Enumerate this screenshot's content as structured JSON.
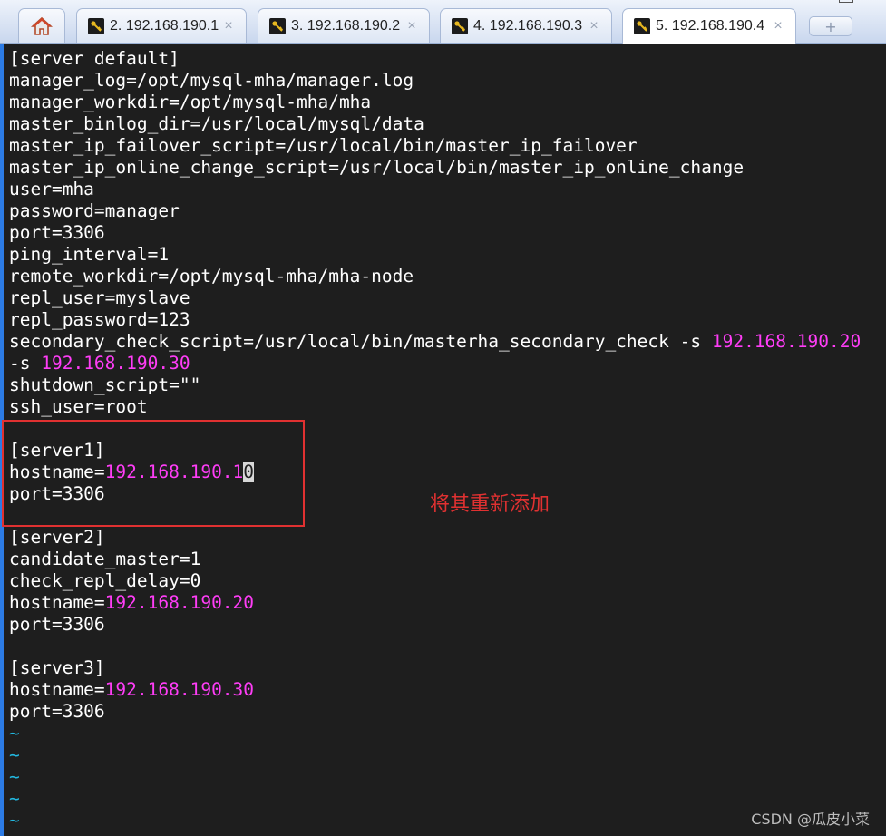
{
  "tabs": [
    {
      "label": "2. 192.168.190.1",
      "active": false
    },
    {
      "label": "3. 192.168.190.2",
      "active": false
    },
    {
      "label": "4. 192.168.190.3",
      "active": false
    },
    {
      "label": "5. 192.168.190.4",
      "active": true
    }
  ],
  "tab_close_glyph": "×",
  "new_tab_glyph": "+",
  "terminal": {
    "lines": [
      {
        "text": "[server default]"
      },
      {
        "text": "manager_log=/opt/mysql-mha/manager.log"
      },
      {
        "text": "manager_workdir=/opt/mysql-mha/mha"
      },
      {
        "text": "master_binlog_dir=/usr/local/mysql/data"
      },
      {
        "text": "master_ip_failover_script=/usr/local/bin/master_ip_failover"
      },
      {
        "text": "master_ip_online_change_script=/usr/local/bin/master_ip_online_change"
      },
      {
        "text": "user=mha"
      },
      {
        "text": "password=manager"
      },
      {
        "text": "port=3306"
      },
      {
        "text": "ping_interval=1"
      },
      {
        "text": "remote_workdir=/opt/mysql-mha/mha-node"
      },
      {
        "text": "repl_user=myslave"
      },
      {
        "text": "repl_password=123"
      },
      {
        "text": "secondary_check_script=/usr/local/bin/masterha_secondary_check -s ",
        "ip": "192.168.190.20"
      },
      {
        "text": "-s ",
        "ip": "192.168.190.30"
      },
      {
        "text": "shutdown_script=\"\""
      },
      {
        "text": "ssh_user=root"
      },
      {
        "text": ""
      },
      {
        "text": "[server1]"
      },
      {
        "text": "hostname=",
        "ip": "192.168.190.1",
        "cursor": "0"
      },
      {
        "text": "port=3306"
      },
      {
        "text": ""
      },
      {
        "text": "[server2]"
      },
      {
        "text": "candidate_master=1"
      },
      {
        "text": "check_repl_delay=0"
      },
      {
        "text": "hostname=",
        "ip": "192.168.190.20"
      },
      {
        "text": "port=3306"
      },
      {
        "text": ""
      },
      {
        "text": "[server3]"
      },
      {
        "text": "hostname=",
        "ip": "192.168.190.30"
      },
      {
        "text": "port=3306"
      },
      {
        "tilde": "~"
      },
      {
        "tilde": "~"
      },
      {
        "tilde": "~"
      },
      {
        "tilde": "~"
      },
      {
        "tilde": "~"
      }
    ]
  },
  "annotation": "将其重新添加",
  "watermark": "CSDN @瓜皮小菜",
  "colors": {
    "background": "#1e1e1e",
    "text": "#ffffff",
    "ip_highlight": "#ff3df7",
    "tilde": "#22b8e0",
    "annotation_red": "#e03131"
  }
}
